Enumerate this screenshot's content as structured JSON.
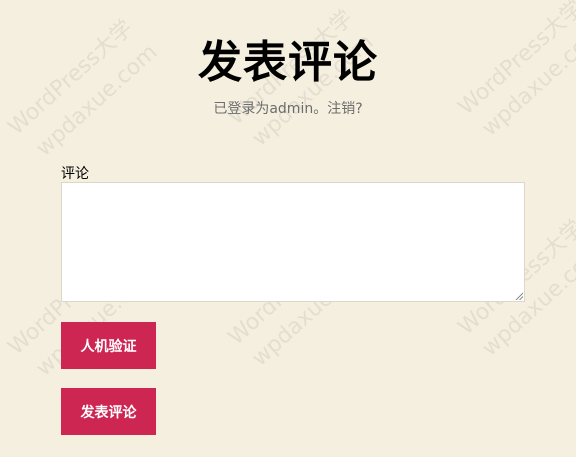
{
  "header": {
    "title": "发表评论"
  },
  "login": {
    "prefix": "已登录为",
    "user": "admin",
    "separator": "。",
    "logout": "注销?"
  },
  "form": {
    "comment_label": "评论",
    "comment_value": "",
    "captcha_button": "人机验证",
    "submit_button": "发表评论"
  },
  "watermarks": [
    "WordPress大学",
    "wpdaxue.com"
  ],
  "colors": {
    "background": "#f5efe0",
    "accent": "#cd2653"
  }
}
